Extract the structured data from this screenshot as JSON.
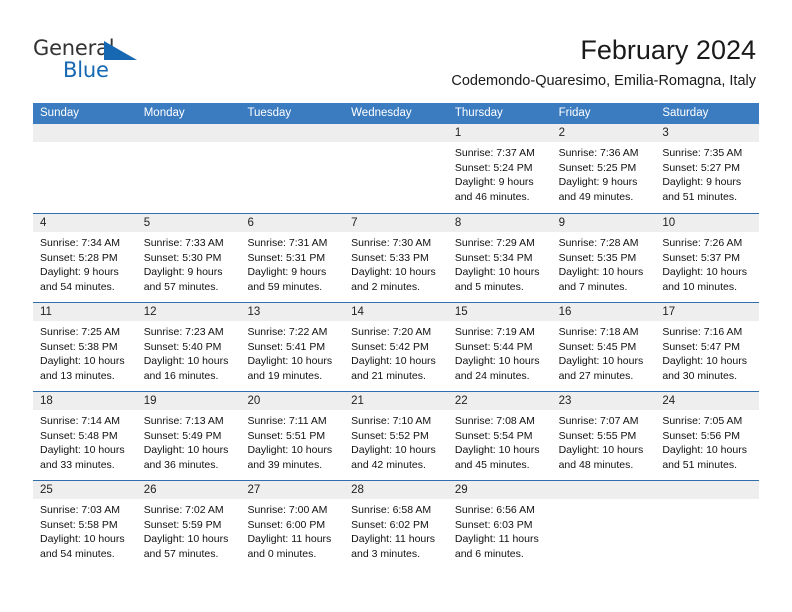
{
  "logo": {
    "word1": "General",
    "word2": "Blue",
    "triangle_color": "#1668b3",
    "text_color": "#333333"
  },
  "header": {
    "title": "February 2024",
    "subtitle": "Codemondo-Quaresimo, Emilia-Romagna, Italy"
  },
  "theme": {
    "header_blue": "#3b7cc0",
    "rule_blue": "#2f6fb0",
    "day_band_gray": "#eeeeee"
  },
  "calendar": {
    "weekdays": [
      "Sunday",
      "Monday",
      "Tuesday",
      "Wednesday",
      "Thursday",
      "Friday",
      "Saturday"
    ],
    "weeks": [
      [
        {
          "day": "",
          "lines": []
        },
        {
          "day": "",
          "lines": []
        },
        {
          "day": "",
          "lines": []
        },
        {
          "day": "",
          "lines": []
        },
        {
          "day": "1",
          "lines": [
            "Sunrise: 7:37 AM",
            "Sunset: 5:24 PM",
            "Daylight: 9 hours",
            "and 46 minutes."
          ]
        },
        {
          "day": "2",
          "lines": [
            "Sunrise: 7:36 AM",
            "Sunset: 5:25 PM",
            "Daylight: 9 hours",
            "and 49 minutes."
          ]
        },
        {
          "day": "3",
          "lines": [
            "Sunrise: 7:35 AM",
            "Sunset: 5:27 PM",
            "Daylight: 9 hours",
            "and 51 minutes."
          ]
        }
      ],
      [
        {
          "day": "4",
          "lines": [
            "Sunrise: 7:34 AM",
            "Sunset: 5:28 PM",
            "Daylight: 9 hours",
            "and 54 minutes."
          ]
        },
        {
          "day": "5",
          "lines": [
            "Sunrise: 7:33 AM",
            "Sunset: 5:30 PM",
            "Daylight: 9 hours",
            "and 57 minutes."
          ]
        },
        {
          "day": "6",
          "lines": [
            "Sunrise: 7:31 AM",
            "Sunset: 5:31 PM",
            "Daylight: 9 hours",
            "and 59 minutes."
          ]
        },
        {
          "day": "7",
          "lines": [
            "Sunrise: 7:30 AM",
            "Sunset: 5:33 PM",
            "Daylight: 10 hours",
            "and 2 minutes."
          ]
        },
        {
          "day": "8",
          "lines": [
            "Sunrise: 7:29 AM",
            "Sunset: 5:34 PM",
            "Daylight: 10 hours",
            "and 5 minutes."
          ]
        },
        {
          "day": "9",
          "lines": [
            "Sunrise: 7:28 AM",
            "Sunset: 5:35 PM",
            "Daylight: 10 hours",
            "and 7 minutes."
          ]
        },
        {
          "day": "10",
          "lines": [
            "Sunrise: 7:26 AM",
            "Sunset: 5:37 PM",
            "Daylight: 10 hours",
            "and 10 minutes."
          ]
        }
      ],
      [
        {
          "day": "11",
          "lines": [
            "Sunrise: 7:25 AM",
            "Sunset: 5:38 PM",
            "Daylight: 10 hours",
            "and 13 minutes."
          ]
        },
        {
          "day": "12",
          "lines": [
            "Sunrise: 7:23 AM",
            "Sunset: 5:40 PM",
            "Daylight: 10 hours",
            "and 16 minutes."
          ]
        },
        {
          "day": "13",
          "lines": [
            "Sunrise: 7:22 AM",
            "Sunset: 5:41 PM",
            "Daylight: 10 hours",
            "and 19 minutes."
          ]
        },
        {
          "day": "14",
          "lines": [
            "Sunrise: 7:20 AM",
            "Sunset: 5:42 PM",
            "Daylight: 10 hours",
            "and 21 minutes."
          ]
        },
        {
          "day": "15",
          "lines": [
            "Sunrise: 7:19 AM",
            "Sunset: 5:44 PM",
            "Daylight: 10 hours",
            "and 24 minutes."
          ]
        },
        {
          "day": "16",
          "lines": [
            "Sunrise: 7:18 AM",
            "Sunset: 5:45 PM",
            "Daylight: 10 hours",
            "and 27 minutes."
          ]
        },
        {
          "day": "17",
          "lines": [
            "Sunrise: 7:16 AM",
            "Sunset: 5:47 PM",
            "Daylight: 10 hours",
            "and 30 minutes."
          ]
        }
      ],
      [
        {
          "day": "18",
          "lines": [
            "Sunrise: 7:14 AM",
            "Sunset: 5:48 PM",
            "Daylight: 10 hours",
            "and 33 minutes."
          ]
        },
        {
          "day": "19",
          "lines": [
            "Sunrise: 7:13 AM",
            "Sunset: 5:49 PM",
            "Daylight: 10 hours",
            "and 36 minutes."
          ]
        },
        {
          "day": "20",
          "lines": [
            "Sunrise: 7:11 AM",
            "Sunset: 5:51 PM",
            "Daylight: 10 hours",
            "and 39 minutes."
          ]
        },
        {
          "day": "21",
          "lines": [
            "Sunrise: 7:10 AM",
            "Sunset: 5:52 PM",
            "Daylight: 10 hours",
            "and 42 minutes."
          ]
        },
        {
          "day": "22",
          "lines": [
            "Sunrise: 7:08 AM",
            "Sunset: 5:54 PM",
            "Daylight: 10 hours",
            "and 45 minutes."
          ]
        },
        {
          "day": "23",
          "lines": [
            "Sunrise: 7:07 AM",
            "Sunset: 5:55 PM",
            "Daylight: 10 hours",
            "and 48 minutes."
          ]
        },
        {
          "day": "24",
          "lines": [
            "Sunrise: 7:05 AM",
            "Sunset: 5:56 PM",
            "Daylight: 10 hours",
            "and 51 minutes."
          ]
        }
      ],
      [
        {
          "day": "25",
          "lines": [
            "Sunrise: 7:03 AM",
            "Sunset: 5:58 PM",
            "Daylight: 10 hours",
            "and 54 minutes."
          ]
        },
        {
          "day": "26",
          "lines": [
            "Sunrise: 7:02 AM",
            "Sunset: 5:59 PM",
            "Daylight: 10 hours",
            "and 57 minutes."
          ]
        },
        {
          "day": "27",
          "lines": [
            "Sunrise: 7:00 AM",
            "Sunset: 6:00 PM",
            "Daylight: 11 hours",
            "and 0 minutes."
          ]
        },
        {
          "day": "28",
          "lines": [
            "Sunrise: 6:58 AM",
            "Sunset: 6:02 PM",
            "Daylight: 11 hours",
            "and 3 minutes."
          ]
        },
        {
          "day": "29",
          "lines": [
            "Sunrise: 6:56 AM",
            "Sunset: 6:03 PM",
            "Daylight: 11 hours",
            "and 6 minutes."
          ]
        },
        {
          "day": "",
          "lines": []
        },
        {
          "day": "",
          "lines": []
        }
      ]
    ]
  }
}
